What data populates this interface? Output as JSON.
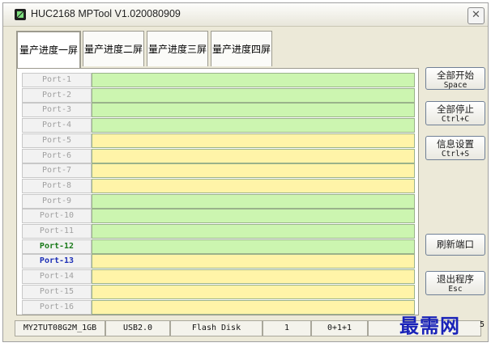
{
  "window": {
    "title": "HUC2168 MPTool V1.020080909",
    "close_glyph": "✕"
  },
  "tabs": [
    {
      "label": "量产进度一屏",
      "active": true
    },
    {
      "label": "量产进度二屏",
      "active": false
    },
    {
      "label": "量产进度三屏",
      "active": false
    },
    {
      "label": "量产进度四屏",
      "active": false
    }
  ],
  "ports": [
    {
      "label": "Port-1",
      "row_color": "#ccf5b0",
      "text_color": "#a0a0a0"
    },
    {
      "label": "Port-2",
      "row_color": "#ccf5b0",
      "text_color": "#a0a0a0"
    },
    {
      "label": "Port-3",
      "row_color": "#ccf5b0",
      "text_color": "#a0a0a0"
    },
    {
      "label": "Port-4",
      "row_color": "#ccf5b0",
      "text_color": "#a0a0a0"
    },
    {
      "label": "Port-5",
      "row_color": "#fff4a8",
      "text_color": "#a0a0a0"
    },
    {
      "label": "Port-6",
      "row_color": "#fff4a8",
      "text_color": "#a0a0a0"
    },
    {
      "label": "Port-7",
      "row_color": "#fff4a8",
      "text_color": "#a0a0a0"
    },
    {
      "label": "Port-8",
      "row_color": "#fff4a8",
      "text_color": "#a0a0a0"
    },
    {
      "label": "Port-9",
      "row_color": "#ccf5b0",
      "text_color": "#a0a0a0"
    },
    {
      "label": "Port-10",
      "row_color": "#ccf5b0",
      "text_color": "#a0a0a0"
    },
    {
      "label": "Port-11",
      "row_color": "#ccf5b0",
      "text_color": "#a0a0a0"
    },
    {
      "label": "Port-12",
      "row_color": "#ccf5b0",
      "text_color": "#1a7a1a"
    },
    {
      "label": "Port-13",
      "row_color": "#fff4a8",
      "text_color": "#1d2fb6"
    },
    {
      "label": "Port-14",
      "row_color": "#fff4a8",
      "text_color": "#a0a0a0"
    },
    {
      "label": "Port-15",
      "row_color": "#fff4a8",
      "text_color": "#a0a0a0"
    },
    {
      "label": "Port-16",
      "row_color": "#fff4a8",
      "text_color": "#a0a0a0"
    }
  ],
  "buttons": {
    "start_all": {
      "label": "全部开始",
      "shortcut": "Space"
    },
    "stop_all": {
      "label": "全部停止",
      "shortcut": "Ctrl+C"
    },
    "settings": {
      "label": "信息设置",
      "shortcut": "Ctrl+S"
    },
    "refresh_ports": {
      "label": "刷新端口"
    },
    "exit": {
      "label": "退出程序",
      "shortcut": "Esc"
    }
  },
  "status_bar": [
    "MY2TUT08G2M_1GB",
    "USB2.0",
    "Flash Disk",
    "1",
    "0+1+1",
    "",
    "5"
  ],
  "watermark": "最需网",
  "colors": {
    "green_row": "#ccf5b0",
    "yellow_row": "#fff4a8",
    "accent_blue": "#1d2fb6"
  }
}
